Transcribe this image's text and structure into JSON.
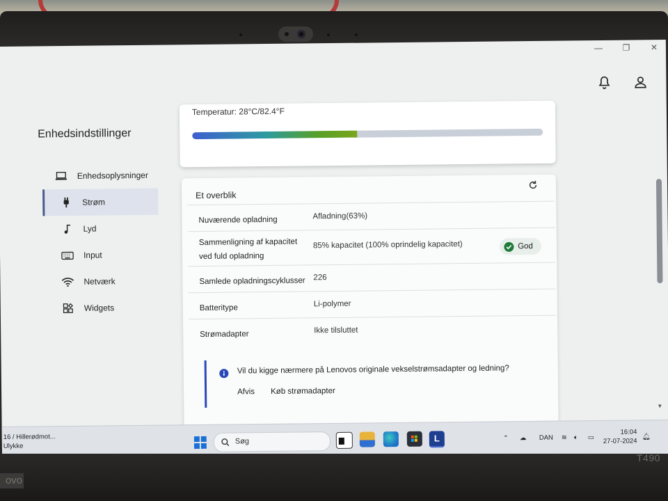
{
  "app": {
    "page_title": "Enhedsindstillinger",
    "window_controls": [
      "minimize-icon",
      "restore-icon",
      "close-icon"
    ],
    "header_icons": [
      "bell-icon",
      "user-icon"
    ]
  },
  "nav": {
    "items": [
      {
        "label": "Enhedsoplysninger",
        "icon": "laptop-icon",
        "active": false
      },
      {
        "label": "Strøm",
        "icon": "plug-icon",
        "active": true
      },
      {
        "label": "Lyd",
        "icon": "music-note-icon",
        "active": false
      },
      {
        "label": "Input",
        "icon": "keyboard-icon",
        "active": false
      },
      {
        "label": "Netværk",
        "icon": "wifi-icon",
        "active": false
      },
      {
        "label": "Widgets",
        "icon": "widgets-icon",
        "active": false
      }
    ]
  },
  "battery_card": {
    "temperature_label": "Temperatur:  28°C/82.4°F",
    "charge_level": 0.47,
    "bar_colors": [
      "#3f5fd0",
      "#2d9ba0",
      "#56a02a",
      "#7aa61c"
    ]
  },
  "overview": {
    "title": "Et overblik",
    "refresh_icon": "refresh-icon",
    "rows": [
      {
        "label": "Nuværende opladning",
        "value": "Afladning(63%)"
      },
      {
        "label_line1": "Sammenligning af kapacitet",
        "label_line2": "ved fuld opladning",
        "value": "85% kapacitet (100% oprindelig kapacitet)",
        "badge": "God",
        "badge_color": "#1f7a3b"
      },
      {
        "label": "Samlede opladningscyklusser",
        "value": "226"
      },
      {
        "label": "Batteritype",
        "value": "Li-polymer"
      },
      {
        "label": "Strømadapter",
        "value": "Ikke tilsluttet"
      }
    ],
    "notice": {
      "text": "Vil du kigge nærmere på Lenovos originale vekselstrømsadapter og ledning?",
      "dismiss": "Afvis",
      "action": "Køb strømadapter",
      "accent": "#2a49b8"
    }
  },
  "taskbar": {
    "news_line1": "16 / Hillerødmot...",
    "news_line2": "Ulykke",
    "search_placeholder": "Søg",
    "language": "DAN",
    "time": "16:04",
    "date": "27-07-2024"
  },
  "laptop": {
    "model": "T490",
    "brand": "ovo"
  }
}
